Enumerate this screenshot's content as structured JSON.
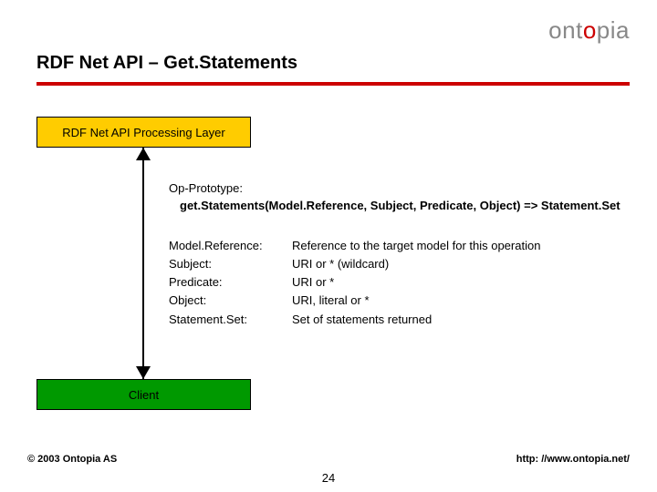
{
  "logo": {
    "part1": "ont",
    "accent": "o",
    "part2": "pia"
  },
  "title": "RDF Net API – Get.Statements",
  "boxes": {
    "api_layer": "RDF Net API Processing Layer",
    "client": "Client"
  },
  "prototype": {
    "label": "Op-Prototype:",
    "signature": "get.Statements(Model.Reference, Subject, Predicate, Object) => Statement.Set"
  },
  "params": [
    {
      "k": "Model.Reference:",
      "v": "Reference to the target model for this operation"
    },
    {
      "k": "Subject:",
      "v": "URI or * (wildcard)"
    },
    {
      "k": "Predicate:",
      "v": "URI or *"
    },
    {
      "k": "Object:",
      "v": "URI, literal or *"
    },
    {
      "k": "Statement.Set:",
      "v": "Set of statements returned"
    }
  ],
  "footer": {
    "copyright": "© 2003 Ontopia AS",
    "url": "http: //www.ontopia.net/",
    "page": "24"
  }
}
